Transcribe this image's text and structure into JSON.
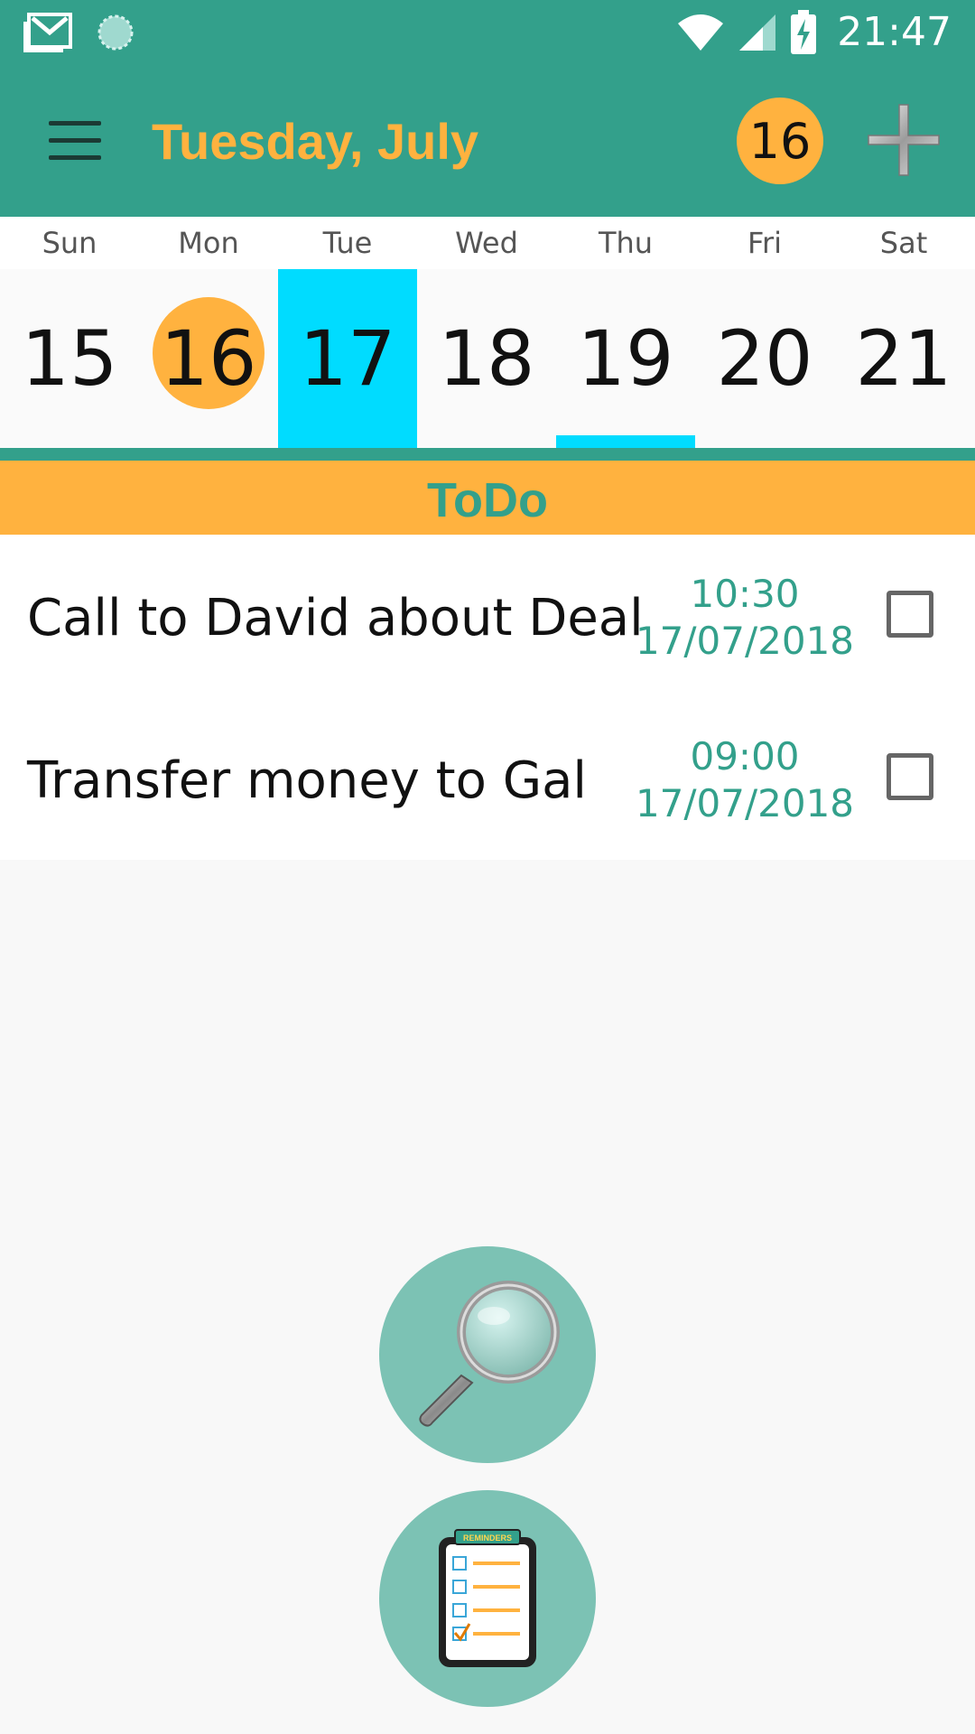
{
  "status_bar": {
    "time": "21:47",
    "icons": [
      "gmail-icon",
      "sync-icon",
      "wifi-icon",
      "signal-icon",
      "battery-charging-icon"
    ]
  },
  "app_bar": {
    "title": "Tuesday, July",
    "today_badge": "16",
    "menu_icon": "menu-icon",
    "add_icon": "add-icon"
  },
  "week": {
    "day_names": [
      "Sun",
      "Mon",
      "Tue",
      "Wed",
      "Thu",
      "Fri",
      "Sat"
    ],
    "day_numbers": [
      "15",
      "16",
      "17",
      "18",
      "19",
      "20",
      "21"
    ],
    "today_index": 1,
    "selected_index": 2,
    "event_marker_index": 4
  },
  "todo": {
    "header": "ToDo",
    "tasks": [
      {
        "title": "Call to David about Deal",
        "time": "10:30",
        "date": "17/07/2018",
        "done": false
      },
      {
        "title": "Transfer money to Gal",
        "time": "09:00",
        "date": "17/07/2018",
        "done": false
      }
    ]
  },
  "fabs": {
    "search_icon": "magnifier-icon",
    "reminders_icon": "reminders-clipboard-icon",
    "reminders_label": "REMINDERS"
  },
  "colors": {
    "primary": "#33a08b",
    "accent": "#ffb23f",
    "selected_day": "#00dcff",
    "fab": "#7cc2b4"
  }
}
